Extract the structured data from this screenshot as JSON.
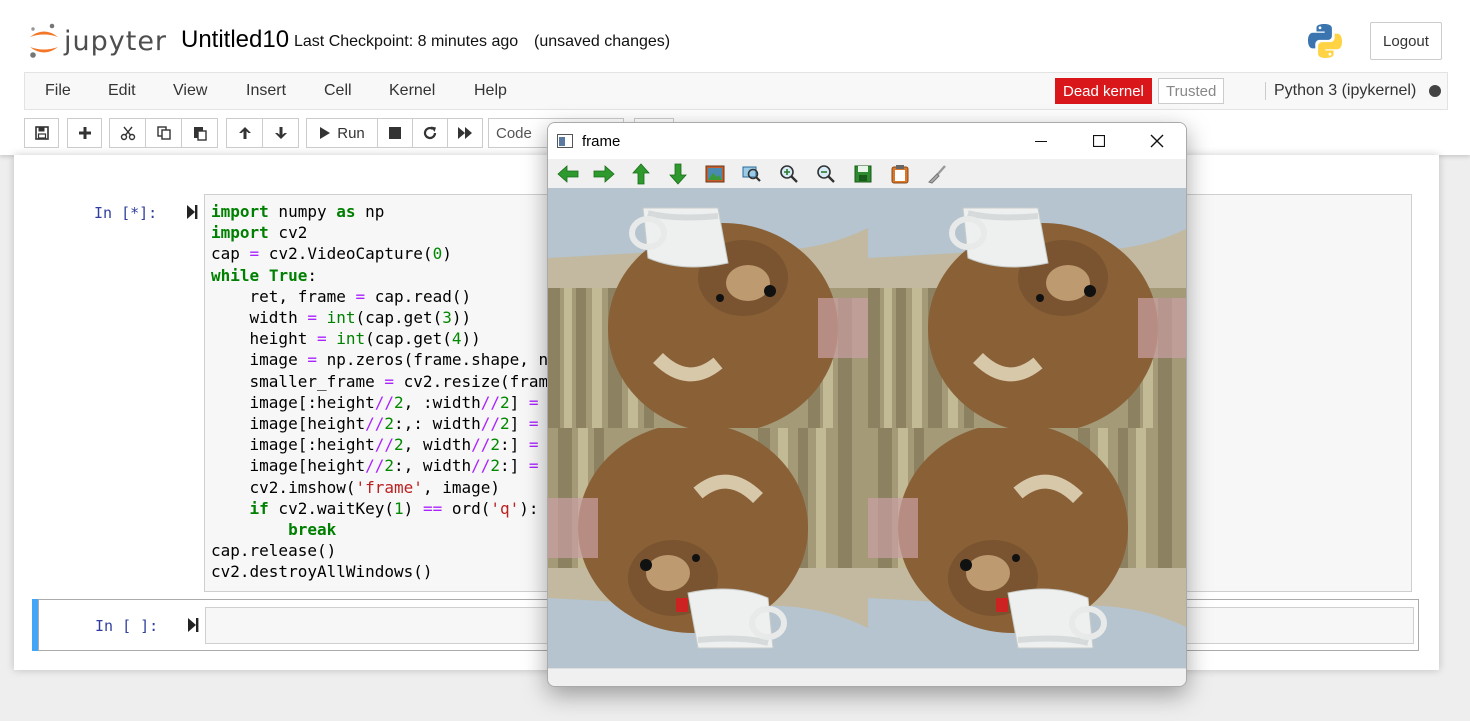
{
  "app": {
    "name": "jupyter"
  },
  "notebook": {
    "name": "Untitled10",
    "checkpoint": "Last Checkpoint: 8 minutes ago",
    "unsaved": "(unsaved changes)"
  },
  "header": {
    "logout_label": "Logout"
  },
  "menu": [
    "File",
    "Edit",
    "View",
    "Insert",
    "Cell",
    "Kernel",
    "Help"
  ],
  "kernel": {
    "status_label": "Dead kernel",
    "trusted_label": "Trusted",
    "name": "Python 3 (ipykernel)"
  },
  "toolbar": {
    "run_label": "Run",
    "cell_type": "Code",
    "icons": [
      "save-icon",
      "plus-icon",
      "cut-icon",
      "copy-icon",
      "paste-icon",
      "arrow-up-icon",
      "arrow-down-icon",
      "play-icon",
      "stop-icon",
      "restart-icon",
      "fast-forward-icon"
    ]
  },
  "cells": [
    {
      "prompt": "In [*]:",
      "lines": [
        "import numpy as np",
        "import cv2",
        "cap = cv2.VideoCapture(0)",
        "while True:",
        "    ret, frame = cap.read()",
        "    width = int(cap.get(3))",
        "    height = int(cap.get(4))",
        "    image = np.zeros(frame.shape, n",
        "    smaller_frame = cv2.resize(fram",
        "    image[:height//2, :width//2] =",
        "    image[height//2:,: width//2] =",
        "    image[:height//2, width//2:] =",
        "    image[height//2:, width//2:] =",
        "    cv2.imshow('frame', image)",
        "    if cv2.waitKey(1) == ord('q'):",
        "        break",
        "cap.release()",
        "cv2.destroyAllWindows()"
      ]
    },
    {
      "prompt": "In [ ]:",
      "lines": []
    }
  ],
  "frame_window": {
    "title": "frame",
    "tools": [
      "arrow-left-icon",
      "arrow-right-icon",
      "arrow-up-icon",
      "arrow-down-icon",
      "image-icon",
      "zoom-window-icon",
      "zoom-in-icon",
      "zoom-out-icon",
      "save-icon",
      "copy-clipboard-icon",
      "properties-icon"
    ]
  },
  "colors": {
    "dead_kernel": "#d9171b",
    "prompt": "#303f9f",
    "keyword": "#008000",
    "operator": "#aa22ff",
    "string": "#ba2121",
    "selected_cell_bar": "#42a5f5"
  }
}
